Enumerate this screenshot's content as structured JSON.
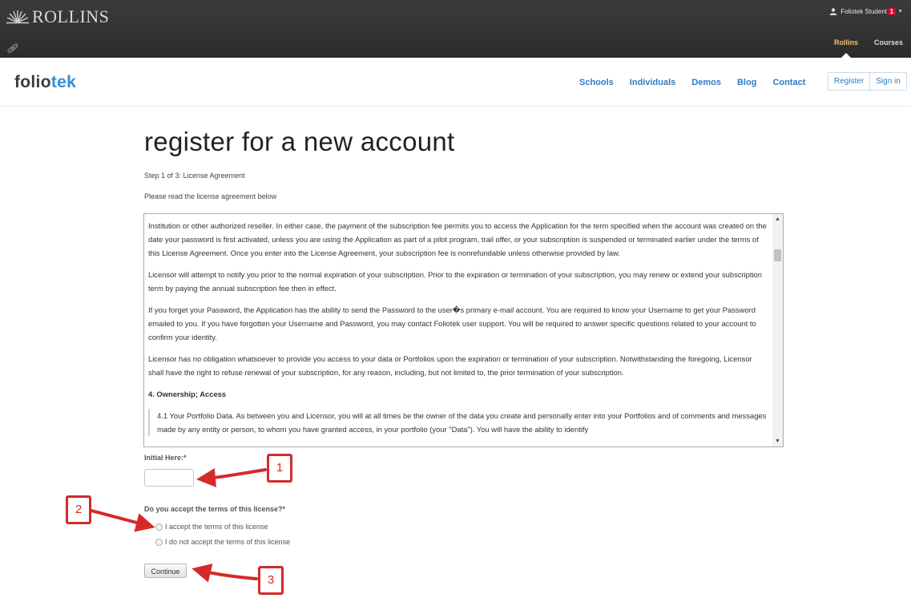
{
  "topbar": {
    "brand": "ROLLINS",
    "user_name": "Foliotek Student",
    "notification_count": "1",
    "nav": [
      "Rollins",
      "Courses"
    ]
  },
  "header": {
    "logo_part1": "folio",
    "logo_part2": "tek",
    "nav": [
      "Schools",
      "Individuals",
      "Demos",
      "Blog",
      "Contact"
    ],
    "register_label": "Register",
    "signin_label": "Sign in"
  },
  "page": {
    "title": "register for a new account",
    "step": "Step 1 of 3: License Agreement",
    "instruction": "Please read the license agreement below"
  },
  "license": {
    "paragraphs": [
      "Institution or other authorized reseller. In either case, the payment of the subscription fee permits you to access the Application for the term specified when the account was created on the date your password is first activated, unless you are using the Application as part of a pilot program, trail offer, or your subscription is suspended or terminated earlier under the terms of this License Agreement. Once you enter into the License Agreement, your subscription fee is nonrefundable unless otherwise provided by law.",
      "Licensor will attempt to notify you prior to the normal expiration of your subscription. Prior to the expiration or termination of your subscription, you may renew or extend your subscription term by paying the annual subscription fee then in effect.",
      "If you forget your Password, the Application has the ability to send the Password to the user�s primary e-mail account. You are required to know your Username to get your Password emailed to you. If you have forgotten your Username and Password, you may contact Foliotek user support. You will be required to answer specific questions related to your account to confirm your identity.",
      "Licensor has no obligation whatsoever to provide you access to your data or Portfolios upon the expiration or termination of your subscription. Notwithstanding the foregoing, Licensor shall have the right to refuse renewal of your subscription, for any reason, including, but not limited to, the prior termination of your subscription."
    ],
    "heading": "4. Ownership; Access",
    "quote": "4.1 Your Portfolio Data. As between you and Licensor, you will at all times be the owner of the data you create and personally enter into your Portfolios and of comments and messages made by any entity or person, to whom you have granted access, in your portfolio (your \"Data\"). You will have the ability to identify"
  },
  "form": {
    "initial_label": "Initial Here:",
    "required_mark": "*",
    "initial_value": "",
    "question": "Do you accept the terms of this license?",
    "options": [
      "I accept the terms of this license",
      "I do not accept the terms of this license"
    ],
    "continue_label": "Continue"
  },
  "annotations": [
    "1",
    "2",
    "3"
  ],
  "colors": {
    "topbar": "#333333",
    "link_blue": "#2e7cc4",
    "logo_blue": "#2f8fd8",
    "active_nav": "#f0c36d",
    "annotation_red": "#d42a2a",
    "badge_red": "#c8102e"
  },
  "icons": [
    "sunburst-logo-icon",
    "link-icon",
    "user-icon",
    "caret-down-icon",
    "scroll-up-icon",
    "scroll-down-icon"
  ]
}
